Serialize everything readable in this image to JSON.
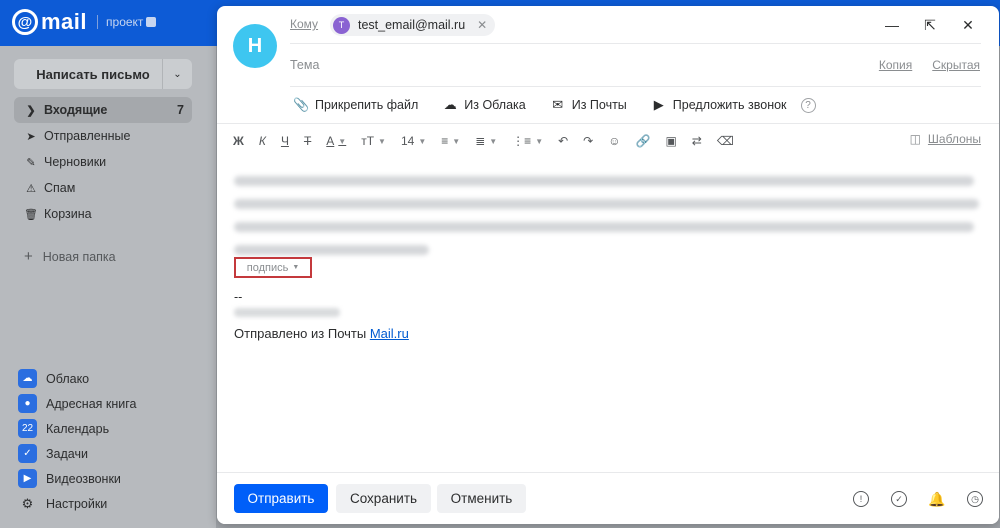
{
  "brand": {
    "logo_at": "@",
    "logo_word": "mail",
    "project": "проект"
  },
  "sidebar": {
    "compose_label": "Написать письмо",
    "folders": [
      {
        "label": "Входящие",
        "count": "7",
        "icon": "chevron-right-icon"
      },
      {
        "label": "Отправленные",
        "count": "",
        "icon": "send-icon"
      },
      {
        "label": "Черновики",
        "count": "",
        "icon": "draft-icon"
      },
      {
        "label": "Спам",
        "count": "",
        "icon": "spam-icon"
      },
      {
        "label": "Корзина",
        "count": "",
        "icon": "trash-icon"
      }
    ],
    "new_folder": "Новая папка",
    "apps": [
      {
        "label": "Облако",
        "color": "#2b6ee0"
      },
      {
        "label": "Адресная книга",
        "color": "#2b6ee0"
      },
      {
        "label": "Календарь",
        "color": "#2b6ee0",
        "badge": "22"
      },
      {
        "label": "Задачи",
        "color": "#2b6ee0"
      },
      {
        "label": "Видеозвонки",
        "color": "#2b6ee0"
      },
      {
        "label": "Настройки",
        "color": ""
      }
    ]
  },
  "compose": {
    "avatar_letter": "H",
    "to_label": "Кому",
    "recipient": {
      "initial": "T",
      "email": "test_email@mail.ru"
    },
    "subject_placeholder": "Тема",
    "cc_label": "Копия",
    "bcc_label": "Скрытая",
    "attach": {
      "file": "Прикрепить файл",
      "cloud": "Из Облака",
      "mail": "Из Почты",
      "call": "Предложить звонок"
    },
    "toolbar": {
      "bold": "Ж",
      "italic": "К",
      "underline": "Ч",
      "strike": "Т",
      "color": "А",
      "size_icon": "тТ",
      "font_size": "14",
      "templates": "Шаблоны"
    },
    "signature_label": "подпись",
    "dashes": "--",
    "sent_from_text": "Отправлено из Почты ",
    "sent_from_link": "Mail.ru"
  },
  "footer": {
    "send": "Отправить",
    "save": "Сохранить",
    "cancel": "Отменить"
  },
  "colors": {
    "accent": "#005ff9",
    "header": "#0d5bd6",
    "avatar": "#3ec6f0",
    "chip_avatar": "#8a63d2",
    "highlight_border": "#c4393c"
  }
}
